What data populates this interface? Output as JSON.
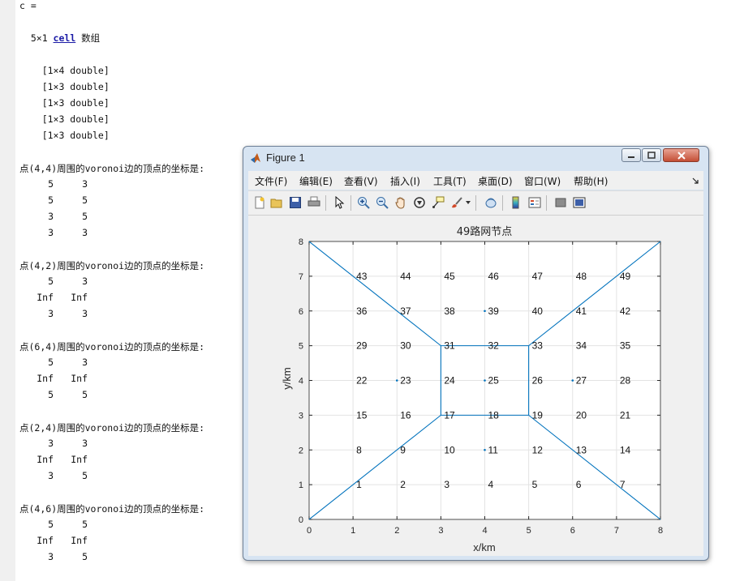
{
  "command_window": {
    "lines": [
      "c =",
      "  5×1 ",
      "cell",
      " 数组",
      "    [1×4 double]",
      "    [1×3 double]",
      "    [1×3 double]",
      "    [1×3 double]",
      "    [1×3 double]"
    ],
    "blocks": [
      {
        "header": "点(4,4)周围的voronoi边的顶点的坐标是:",
        "rows": [
          [
            "5",
            "3"
          ],
          [
            "5",
            "5"
          ],
          [
            "3",
            "5"
          ],
          [
            "3",
            "3"
          ]
        ]
      },
      {
        "header": "点(4,2)周围的voronoi边的顶点的坐标是:",
        "rows": [
          [
            "5",
            "3"
          ],
          [
            "Inf",
            "Inf"
          ],
          [
            "3",
            "3"
          ]
        ]
      },
      {
        "header": "点(6,4)周围的voronoi边的顶点的坐标是:",
        "rows": [
          [
            "5",
            "3"
          ],
          [
            "Inf",
            "Inf"
          ],
          [
            "5",
            "5"
          ]
        ]
      },
      {
        "header": "点(2,4)周围的voronoi边的顶点的坐标是:",
        "rows": [
          [
            "3",
            "3"
          ],
          [
            "Inf",
            "Inf"
          ],
          [
            "3",
            "5"
          ]
        ]
      },
      {
        "header": "点(4,6)周围的voronoi边的顶点的坐标是:",
        "rows": [
          [
            "5",
            "5"
          ],
          [
            "Inf",
            "Inf"
          ],
          [
            "3",
            "5"
          ]
        ]
      }
    ]
  },
  "figure": {
    "title": "Figure 1",
    "menus": [
      "文件(F)",
      "编辑(E)",
      "查看(V)",
      "插入(I)",
      "工具(T)",
      "桌面(D)",
      "窗口(W)",
      "帮助(H)"
    ],
    "toolbar_icons": [
      "new-figure-icon",
      "open-file-icon",
      "save-icon",
      "print-icon",
      "pointer-icon",
      "zoom-in-icon",
      "zoom-out-icon",
      "pan-icon",
      "rotate-icon",
      "data-cursor-icon",
      "brush-icon",
      "link-plot-icon",
      "colorbar-icon",
      "legend-icon",
      "hide-plot-tools-icon",
      "show-plot-tools-icon"
    ]
  },
  "chart_data": {
    "type": "scatter",
    "title": "49路网节点",
    "xlabel": "x/km",
    "ylabel": "y/km",
    "xlim": [
      0,
      8
    ],
    "ylim": [
      0,
      8
    ],
    "xticks": [
      "0",
      "1",
      "2",
      "3",
      "4",
      "5",
      "6",
      "7",
      "8"
    ],
    "yticks": [
      "0",
      "1",
      "2",
      "3",
      "4",
      "5",
      "6",
      "7",
      "8"
    ],
    "grid": true,
    "line_color": "#0072bd",
    "node_labels": [
      {
        "label": "1",
        "x": 1,
        "y": 1
      },
      {
        "label": "2",
        "x": 2,
        "y": 1
      },
      {
        "label": "3",
        "x": 3,
        "y": 1
      },
      {
        "label": "4",
        "x": 4,
        "y": 1
      },
      {
        "label": "5",
        "x": 5,
        "y": 1
      },
      {
        "label": "6",
        "x": 6,
        "y": 1
      },
      {
        "label": "7",
        "x": 7,
        "y": 1
      },
      {
        "label": "8",
        "x": 1,
        "y": 2
      },
      {
        "label": "9",
        "x": 2,
        "y": 2
      },
      {
        "label": "10",
        "x": 3,
        "y": 2
      },
      {
        "label": "11",
        "x": 4,
        "y": 2
      },
      {
        "label": "12",
        "x": 5,
        "y": 2
      },
      {
        "label": "13",
        "x": 6,
        "y": 2
      },
      {
        "label": "14",
        "x": 7,
        "y": 2
      },
      {
        "label": "15",
        "x": 1,
        "y": 3
      },
      {
        "label": "16",
        "x": 2,
        "y": 3
      },
      {
        "label": "17",
        "x": 3,
        "y": 3
      },
      {
        "label": "18",
        "x": 4,
        "y": 3
      },
      {
        "label": "19",
        "x": 5,
        "y": 3
      },
      {
        "label": "20",
        "x": 6,
        "y": 3
      },
      {
        "label": "21",
        "x": 7,
        "y": 3
      },
      {
        "label": "22",
        "x": 1,
        "y": 4
      },
      {
        "label": "23",
        "x": 2,
        "y": 4
      },
      {
        "label": "24",
        "x": 3,
        "y": 4
      },
      {
        "label": "25",
        "x": 4,
        "y": 4
      },
      {
        "label": "26",
        "x": 5,
        "y": 4
      },
      {
        "label": "27",
        "x": 6,
        "y": 4
      },
      {
        "label": "28",
        "x": 7,
        "y": 4
      },
      {
        "label": "29",
        "x": 1,
        "y": 5
      },
      {
        "label": "30",
        "x": 2,
        "y": 5
      },
      {
        "label": "31",
        "x": 3,
        "y": 5
      },
      {
        "label": "32",
        "x": 4,
        "y": 5
      },
      {
        "label": "33",
        "x": 5,
        "y": 5
      },
      {
        "label": "34",
        "x": 6,
        "y": 5
      },
      {
        "label": "35",
        "x": 7,
        "y": 5
      },
      {
        "label": "36",
        "x": 1,
        "y": 6
      },
      {
        "label": "37",
        "x": 2,
        "y": 6
      },
      {
        "label": "38",
        "x": 3,
        "y": 6
      },
      {
        "label": "39",
        "x": 4,
        "y": 6
      },
      {
        "label": "40",
        "x": 5,
        "y": 6
      },
      {
        "label": "41",
        "x": 6,
        "y": 6
      },
      {
        "label": "42",
        "x": 7,
        "y": 6
      },
      {
        "label": "43",
        "x": 1,
        "y": 7
      },
      {
        "label": "44",
        "x": 2,
        "y": 7
      },
      {
        "label": "45",
        "x": 3,
        "y": 7
      },
      {
        "label": "46",
        "x": 4,
        "y": 7
      },
      {
        "label": "47",
        "x": 5,
        "y": 7
      },
      {
        "label": "48",
        "x": 6,
        "y": 7
      },
      {
        "label": "49",
        "x": 7,
        "y": 7
      }
    ],
    "points": [
      [
        4,
        4
      ],
      [
        4,
        2
      ],
      [
        6,
        4
      ],
      [
        2,
        4
      ],
      [
        4,
        6
      ]
    ],
    "voronoi_edges": [
      [
        [
          3,
          3
        ],
        [
          5,
          3
        ]
      ],
      [
        [
          5,
          3
        ],
        [
          5,
          5
        ]
      ],
      [
        [
          5,
          5
        ],
        [
          3,
          5
        ]
      ],
      [
        [
          3,
          5
        ],
        [
          3,
          3
        ]
      ],
      [
        [
          0,
          0
        ],
        [
          3,
          3
        ]
      ],
      [
        [
          5,
          3
        ],
        [
          8,
          0
        ]
      ],
      [
        [
          5,
          5
        ],
        [
          8,
          8
        ]
      ],
      [
        [
          3,
          5
        ],
        [
          0,
          8
        ]
      ]
    ]
  }
}
